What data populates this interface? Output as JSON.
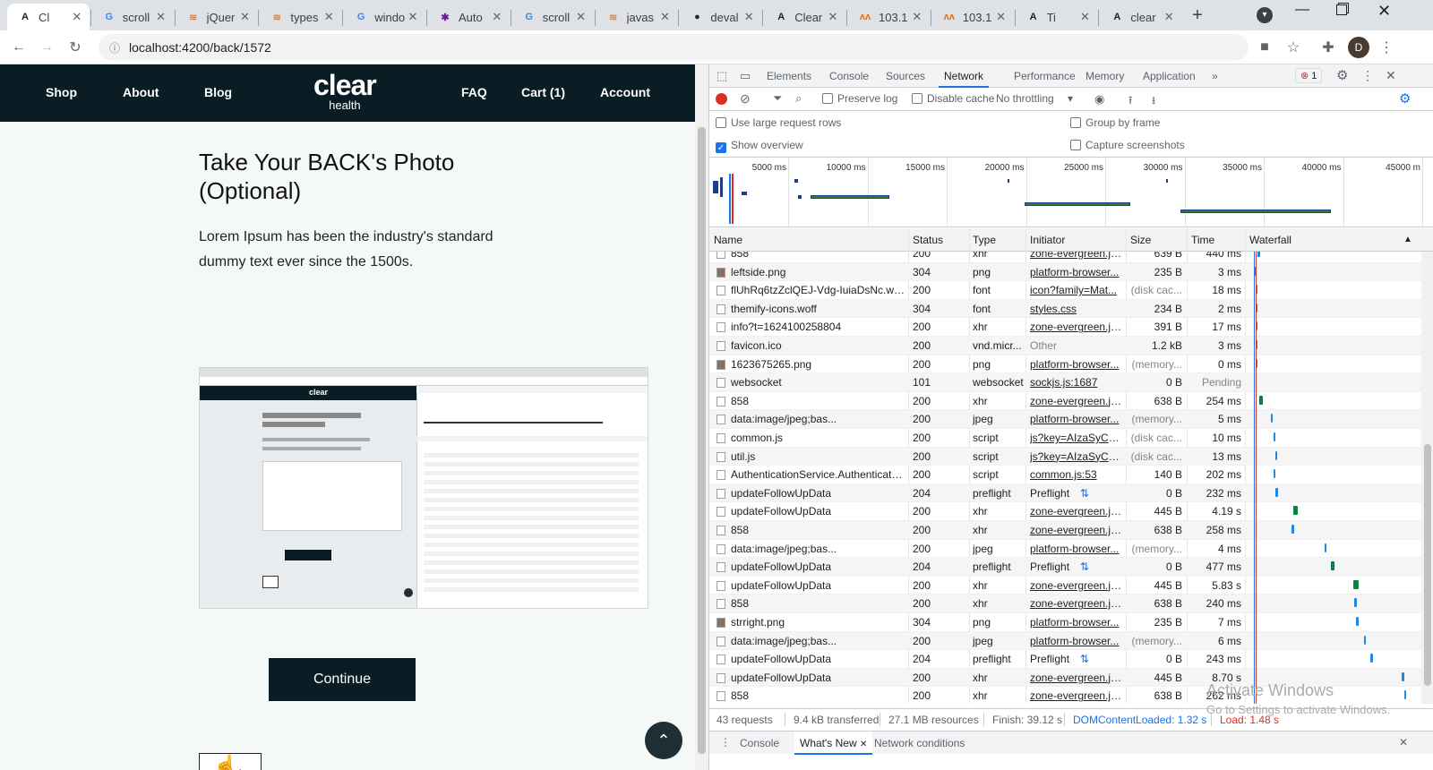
{
  "browser": {
    "tabs": [
      {
        "title": "Cl",
        "favicon": "angular-icon",
        "active": true
      },
      {
        "title": "scroll",
        "favicon": "google-icon"
      },
      {
        "title": "jQuer",
        "favicon": "stackoverflow-icon"
      },
      {
        "title": "types",
        "favicon": "stackoverflow-icon"
      },
      {
        "title": "windo",
        "favicon": "google-icon"
      },
      {
        "title": "Auto",
        "favicon": "generic-icon"
      },
      {
        "title": "scroll",
        "favicon": "google-icon"
      },
      {
        "title": "javas",
        "favicon": "stackoverflow-icon"
      },
      {
        "title": "deval",
        "favicon": "github-icon"
      },
      {
        "title": "Clear",
        "favicon": "angular-icon"
      },
      {
        "title": "103.1",
        "favicon": "grafana-icon"
      },
      {
        "title": "103.1",
        "favicon": "grafana-icon"
      },
      {
        "title": "Ti",
        "favicon": "angular-icon"
      },
      {
        "title": "clear",
        "favicon": "angular-icon"
      }
    ],
    "url": "localhost:4200/back/1572",
    "profile_initial": "D"
  },
  "site": {
    "nav_left": [
      "Shop",
      "About",
      "Blog"
    ],
    "logo_main": "clear",
    "logo_sub": "health",
    "nav_right": [
      "FAQ",
      "Cart (1)",
      "Account"
    ],
    "heading": "Take Your BACK's Photo (Optional)",
    "paragraph": "Lorem Ipsum has been the industry's standard dummy text ever since the 1500s.",
    "continue_label": "Continue",
    "click_label": "Click"
  },
  "devtools": {
    "tabs": [
      "Elements",
      "Console",
      "Sources",
      "Network",
      "Performance",
      "Memory",
      "Application"
    ],
    "active_tab": "Network",
    "error_count": "1",
    "preserve_log": "Preserve log",
    "disable_cache": "Disable cache",
    "throttling": "No throttling",
    "settings": {
      "large_rows": "Use large request rows",
      "show_overview": "Show overview",
      "group_by_frame": "Group by frame",
      "capture_screenshots": "Capture screenshots"
    },
    "overview_ticks": [
      "5000 ms",
      "10000 ms",
      "15000 ms",
      "20000 ms",
      "25000 ms",
      "30000 ms",
      "35000 ms",
      "40000 ms",
      "45000 m"
    ],
    "columns": [
      "Name",
      "Status",
      "Type",
      "Initiator",
      "Size",
      "Time",
      "Waterfall"
    ],
    "requests": [
      {
        "name": "858",
        "status": "200",
        "type": "xhr",
        "initiator": "zone-evergreen.js...",
        "size": "639 B",
        "time": "440 ms",
        "link": true
      },
      {
        "name": "leftside.png",
        "status": "304",
        "type": "png",
        "initiator": "platform-browser...",
        "size": "235 B",
        "time": "3 ms",
        "link": true,
        "img": true
      },
      {
        "name": "flUhRq6tzZclQEJ-Vdg-IuiaDsNc.woff2",
        "status": "200",
        "type": "font",
        "initiator": "icon?family=Mat...",
        "size": "(disk cac...",
        "time": "18 ms",
        "link": true
      },
      {
        "name": "themify-icons.woff",
        "status": "304",
        "type": "font",
        "initiator": "styles.css",
        "size": "234 B",
        "time": "2 ms",
        "link": true
      },
      {
        "name": "info?t=1624100258804",
        "status": "200",
        "type": "xhr",
        "initiator": "zone-evergreen.js...",
        "size": "391 B",
        "time": "17 ms",
        "link": true
      },
      {
        "name": "favicon.ico",
        "status": "200",
        "type": "vnd.micr...",
        "initiator": "Other",
        "size": "1.2 kB",
        "time": "3 ms",
        "link": false
      },
      {
        "name": "1623675265.png",
        "status": "200",
        "type": "png",
        "initiator": "platform-browser...",
        "size": "(memory...",
        "time": "0 ms",
        "link": true,
        "img": true
      },
      {
        "name": "websocket",
        "status": "101",
        "type": "websocket",
        "initiator": "sockjs.js:1687",
        "size": "0 B",
        "time": "Pending",
        "link": true
      },
      {
        "name": "858",
        "status": "200",
        "type": "xhr",
        "initiator": "zone-evergreen.js...",
        "size": "638 B",
        "time": "254 ms",
        "link": true
      },
      {
        "name": "data:image/jpeg;bas...",
        "status": "200",
        "type": "jpeg",
        "initiator": "platform-browser...",
        "size": "(memory...",
        "time": "5 ms",
        "link": true
      },
      {
        "name": "common.js",
        "status": "200",
        "type": "script",
        "initiator": "js?key=AIzaSyCS...",
        "size": "(disk cac...",
        "time": "10 ms",
        "link": true
      },
      {
        "name": "util.js",
        "status": "200",
        "type": "script",
        "initiator": "js?key=AIzaSyCS...",
        "size": "(disk cac...",
        "time": "13 ms",
        "link": true
      },
      {
        "name": "AuthenticationService.Authenticate...",
        "status": "200",
        "type": "script",
        "initiator": "common.js:53",
        "size": "140 B",
        "time": "202 ms",
        "link": true
      },
      {
        "name": "updateFollowUpData",
        "status": "204",
        "type": "preflight",
        "initiator": "Preflight",
        "size": "0 B",
        "time": "232 ms",
        "link": false,
        "pre": true
      },
      {
        "name": "updateFollowUpData",
        "status": "200",
        "type": "xhr",
        "initiator": "zone-evergreen.js...",
        "size": "445 B",
        "time": "4.19 s",
        "link": true
      },
      {
        "name": "858",
        "status": "200",
        "type": "xhr",
        "initiator": "zone-evergreen.js...",
        "size": "638 B",
        "time": "258 ms",
        "link": true
      },
      {
        "name": "data:image/jpeg;bas...",
        "status": "200",
        "type": "jpeg",
        "initiator": "platform-browser...",
        "size": "(memory...",
        "time": "4 ms",
        "link": true
      },
      {
        "name": "updateFollowUpData",
        "status": "204",
        "type": "preflight",
        "initiator": "Preflight",
        "size": "0 B",
        "time": "477 ms",
        "link": false,
        "pre": true
      },
      {
        "name": "updateFollowUpData",
        "status": "200",
        "type": "xhr",
        "initiator": "zone-evergreen.js...",
        "size": "445 B",
        "time": "5.83 s",
        "link": true
      },
      {
        "name": "858",
        "status": "200",
        "type": "xhr",
        "initiator": "zone-evergreen.js...",
        "size": "638 B",
        "time": "240 ms",
        "link": true
      },
      {
        "name": "strright.png",
        "status": "304",
        "type": "png",
        "initiator": "platform-browser...",
        "size": "235 B",
        "time": "7 ms",
        "link": true,
        "img": true
      },
      {
        "name": "data:image/jpeg;bas...",
        "status": "200",
        "type": "jpeg",
        "initiator": "platform-browser...",
        "size": "(memory...",
        "time": "6 ms",
        "link": true
      },
      {
        "name": "updateFollowUpData",
        "status": "204",
        "type": "preflight",
        "initiator": "Preflight",
        "size": "0 B",
        "time": "243 ms",
        "link": false,
        "pre": true
      },
      {
        "name": "updateFollowUpData",
        "status": "200",
        "type": "xhr",
        "initiator": "zone-evergreen.js...",
        "size": "445 B",
        "time": "8.70 s",
        "link": true
      },
      {
        "name": "858",
        "status": "200",
        "type": "xhr",
        "initiator": "zone-evergreen.js...",
        "size": "638 B",
        "time": "262 ms",
        "link": true
      }
    ],
    "status": {
      "requests": "43 requests",
      "transferred": "9.4 kB transferred",
      "resources": "27.1 MB resources",
      "finish": "Finish: 39.12 s",
      "domcontentloaded": "DOMContentLoaded: 1.32 s",
      "load": "Load: 1.48 s"
    },
    "drawer_tabs": [
      "Console",
      "What's New",
      "Network conditions"
    ]
  },
  "watermark": {
    "line1": "Activate Windows",
    "line2": "Go to Settings to activate Windows."
  },
  "colors": {
    "nav_bg": "#0a1d24",
    "page_bg": "#f4f8f7",
    "accent_blue": "#1a73e8",
    "dcl_blue": "#1a73e8",
    "load_red": "#d93025"
  }
}
